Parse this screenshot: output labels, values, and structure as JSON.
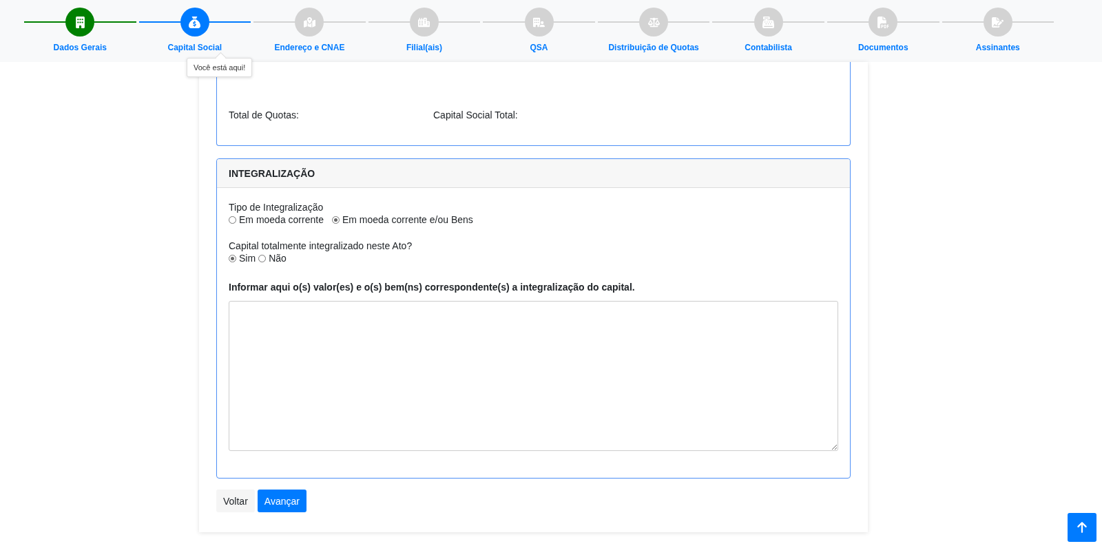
{
  "steps": [
    {
      "label": "Dados Gerais",
      "done": true,
      "selected": false
    },
    {
      "label": "Capital Social",
      "done": false,
      "selected": true
    },
    {
      "label": "Endereço e CNAE",
      "done": false,
      "selected": false
    },
    {
      "label": "Filial(ais)",
      "done": false,
      "selected": false
    },
    {
      "label": "QSA",
      "done": false,
      "selected": false
    },
    {
      "label": "Distribuição de Quotas",
      "done": false,
      "selected": false
    },
    {
      "label": "Contabilista",
      "done": false,
      "selected": false
    },
    {
      "label": "Documentos",
      "done": false,
      "selected": false
    },
    {
      "label": "Assinantes",
      "done": false,
      "selected": false
    }
  ],
  "tooltip": "Você está aqui!",
  "totals": {
    "quotas_label": "Total de Quotas:",
    "capital_label": "Capital Social Total:"
  },
  "integralizacao": {
    "title": "INTEGRALIZAÇÃO",
    "tipo": {
      "label": "Tipo de Integralização",
      "options": [
        {
          "label": "Em moeda corrente",
          "selected": false
        },
        {
          "label": "Em moeda corrente e/ou Bens",
          "selected": true
        }
      ]
    },
    "total": {
      "label": "Capital totalmente integralizado neste Ato?",
      "options": [
        {
          "label": "Sim",
          "selected": true
        },
        {
          "label": "Não",
          "selected": false
        }
      ]
    },
    "instructions": "Informar aqui o(s) valor(es) e o(s) bem(ns) correspondente(s) a integralização do capital."
  },
  "buttons": [
    {
      "label": "Voltar",
      "kind": "secondary"
    },
    {
      "label": "Avançar",
      "kind": "primary"
    }
  ]
}
